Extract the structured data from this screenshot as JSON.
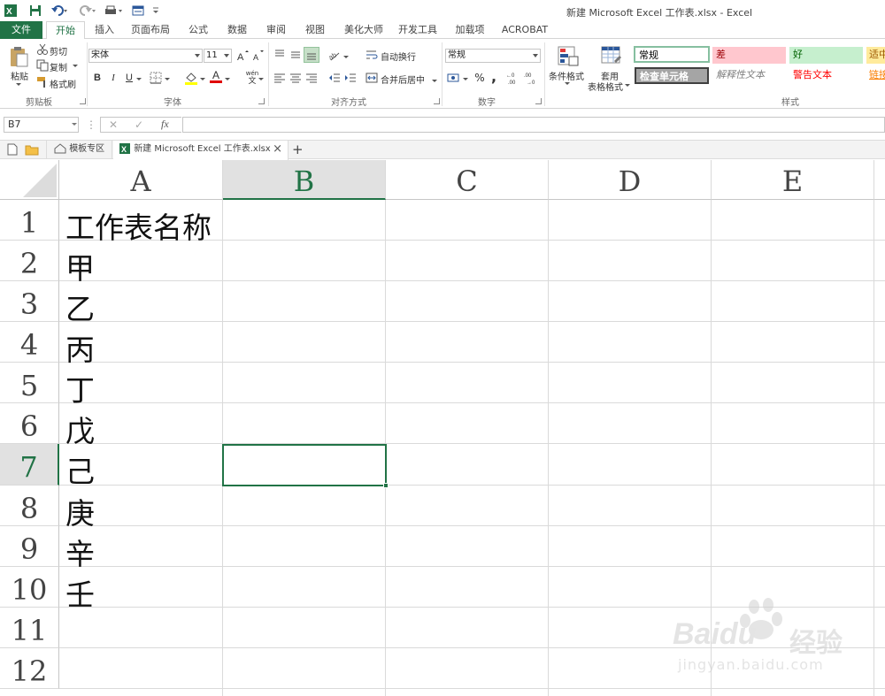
{
  "window": {
    "title": "新建 Microsoft Excel 工作表.xlsx - Excel"
  },
  "ribbon_tabs": [
    "文件",
    "开始",
    "插入",
    "页面布局",
    "公式",
    "数据",
    "审阅",
    "视图",
    "美化大师",
    "开发工具",
    "加载项",
    "ACROBAT"
  ],
  "active_tab": "开始",
  "clipboard": {
    "paste": "粘贴",
    "cut": "剪切",
    "copy": "复制",
    "format_painter": "格式刷",
    "group": "剪贴板"
  },
  "font": {
    "name": "宋体",
    "size": "11",
    "bold": "B",
    "italic": "I",
    "underline": "U",
    "font_color_letter": "A",
    "font_color": "#e00000",
    "fill_color": "#ffff00",
    "phonetic": "wén",
    "phonetic_sub": "文",
    "group": "字体"
  },
  "alignment": {
    "wrap": "自动换行",
    "merge": "合并后居中",
    "group": "对齐方式"
  },
  "number": {
    "format": "常规",
    "percent": "%",
    "comma": ",",
    "group": "数字"
  },
  "styles": {
    "conditional": "条件格式",
    "table_format_1": "套用",
    "table_format_2": "表格格式",
    "cells": [
      {
        "label": "常规",
        "bg": "#ffffff",
        "color": "#000000"
      },
      {
        "label": "差",
        "bg": "#ffc7ce",
        "color": "#9c0006"
      },
      {
        "label": "好",
        "bg": "#c6efce",
        "color": "#006100"
      },
      {
        "label": "适中",
        "bg": "#ffeb9c",
        "color": "#9c5700"
      },
      {
        "label": "检查单元格",
        "bg": "#a5a5a5",
        "color": "#ffffff"
      },
      {
        "label": "解释性文本",
        "bg": "#ffffff",
        "color": "#7f7f7f"
      },
      {
        "label": "警告文本",
        "bg": "#ffffff",
        "color": "#ff0000"
      },
      {
        "label": "链接",
        "bg": "#ffffff",
        "color": "#fa7d00"
      }
    ],
    "group": "样式"
  },
  "formula_bar": {
    "name_box": "B7",
    "fx": "fx",
    "formula": ""
  },
  "doc_tabs": {
    "template": "模板专区",
    "file": "新建 Microsoft Excel 工作表.xlsx",
    "close": "×",
    "add": "+"
  },
  "sheet": {
    "columns": [
      "A",
      "B",
      "C",
      "D",
      "E"
    ],
    "rows": [
      "1",
      "2",
      "3",
      "4",
      "5",
      "6",
      "7",
      "8",
      "9",
      "10",
      "11",
      "12"
    ],
    "selected_col": "B",
    "selected_row": "7",
    "cells_A": [
      "工作表名称",
      "甲",
      "乙",
      "丙",
      "丁",
      "戊",
      "己",
      "庚",
      "辛",
      "壬",
      "",
      ""
    ]
  },
  "accent": "#217346",
  "watermark": {
    "brand": "Baidu",
    "cn": "经验",
    "url": "jingyan.baidu.com"
  }
}
